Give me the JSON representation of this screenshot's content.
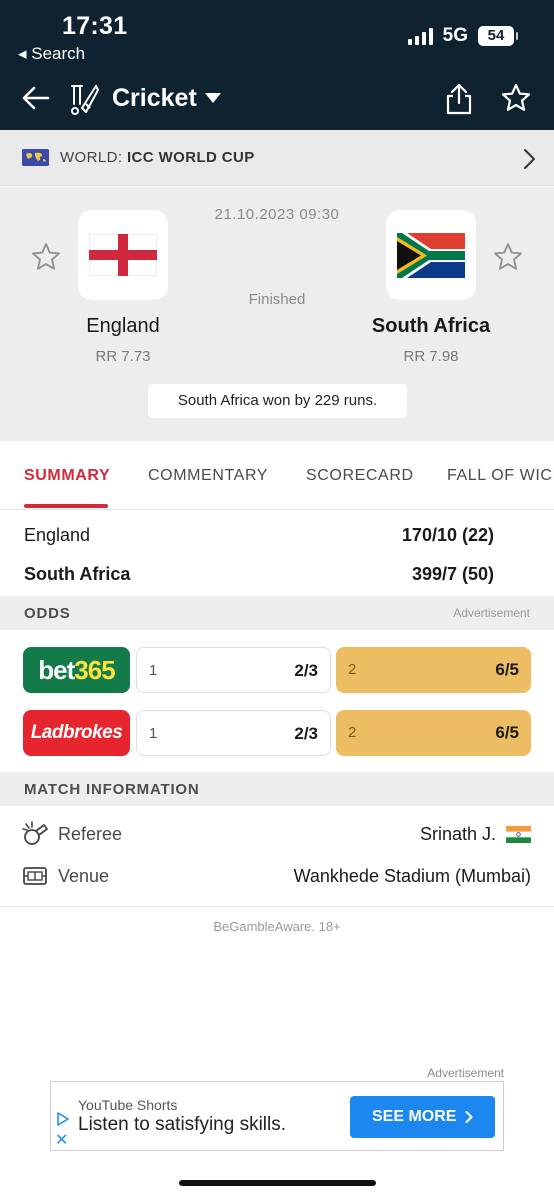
{
  "status": {
    "time": "17:31",
    "back_label": "◂ Search",
    "network": "5G",
    "battery": "54"
  },
  "header": {
    "title": "Cricket"
  },
  "league": {
    "region": "WORLD:",
    "competition": "ICC WORLD CUP"
  },
  "match": {
    "datetime": "21.10.2023 09:30",
    "status": "Finished",
    "home": {
      "name": "England",
      "rr": "RR 7.73"
    },
    "away": {
      "name": "South Africa",
      "rr": "RR 7.98"
    },
    "result": "South Africa won by 229 runs."
  },
  "tabs": [
    "SUMMARY",
    "COMMENTARY",
    "SCORECARD",
    "FALL OF WICKETS"
  ],
  "scores": [
    {
      "team": "England",
      "score": "170/10 (22)"
    },
    {
      "team": "South Africa",
      "score": "399/7 (50)"
    }
  ],
  "odds": {
    "title": "ODDS",
    "ad_label": "Advertisement",
    "bookmakers": [
      {
        "name_a": "bet",
        "name_b": "365",
        "odd1_label": "1",
        "odd1": "2/3",
        "odd2_label": "2",
        "odd2": "6/5"
      },
      {
        "name": "Ladbrokes",
        "odd1_label": "1",
        "odd1": "2/3",
        "odd2_label": "2",
        "odd2": "6/5"
      }
    ]
  },
  "match_info": {
    "title": "MATCH INFORMATION",
    "referee_label": "Referee",
    "referee": "Srinath J.",
    "venue_label": "Venue",
    "venue": "Wankhede Stadium (Mumbai)"
  },
  "gamble_notice": "BeGambleAware. 18+",
  "banner_ad": {
    "label": "Advertisement",
    "source": "YouTube Shorts",
    "text": "Listen to satisfying skills.",
    "cta": "SEE MORE",
    "close": "✕"
  },
  "colors": {
    "header_bg": "#0f2230",
    "accent": "#d42a3a",
    "odds_highlight": "#ecbd63",
    "bet365": "#137a4a",
    "ladbrokes": "#e6252f",
    "cta": "#1b87ef"
  }
}
